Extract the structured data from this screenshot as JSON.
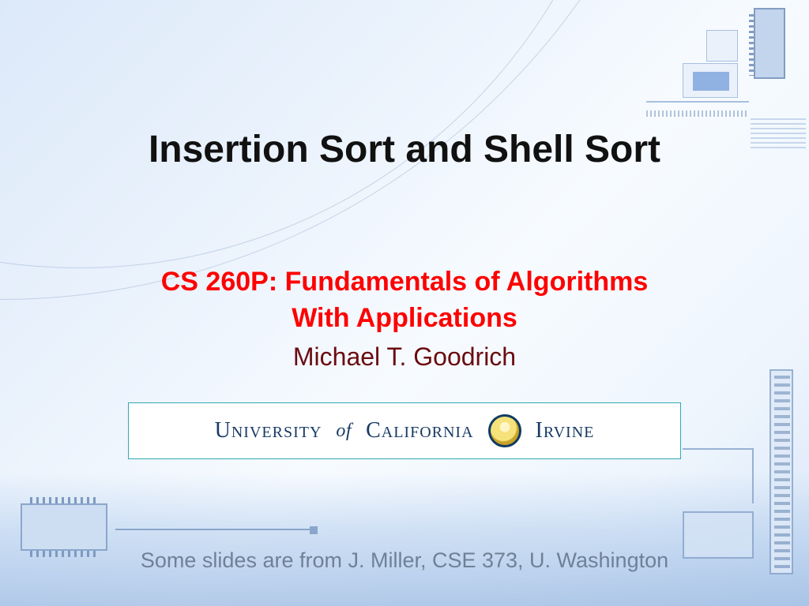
{
  "slide": {
    "title": "Insertion Sort and Shell Sort",
    "course_line1": "CS 260P: Fundamentals of Algorithms",
    "course_line2": "With Applications",
    "author": "Michael T. Goodrich",
    "banner": {
      "university_word": "University",
      "of_word": "of",
      "california_word": "California",
      "campus_word": "Irvine"
    },
    "credit": "Some slides are from J. Miller, CSE 373, U. Washington"
  }
}
